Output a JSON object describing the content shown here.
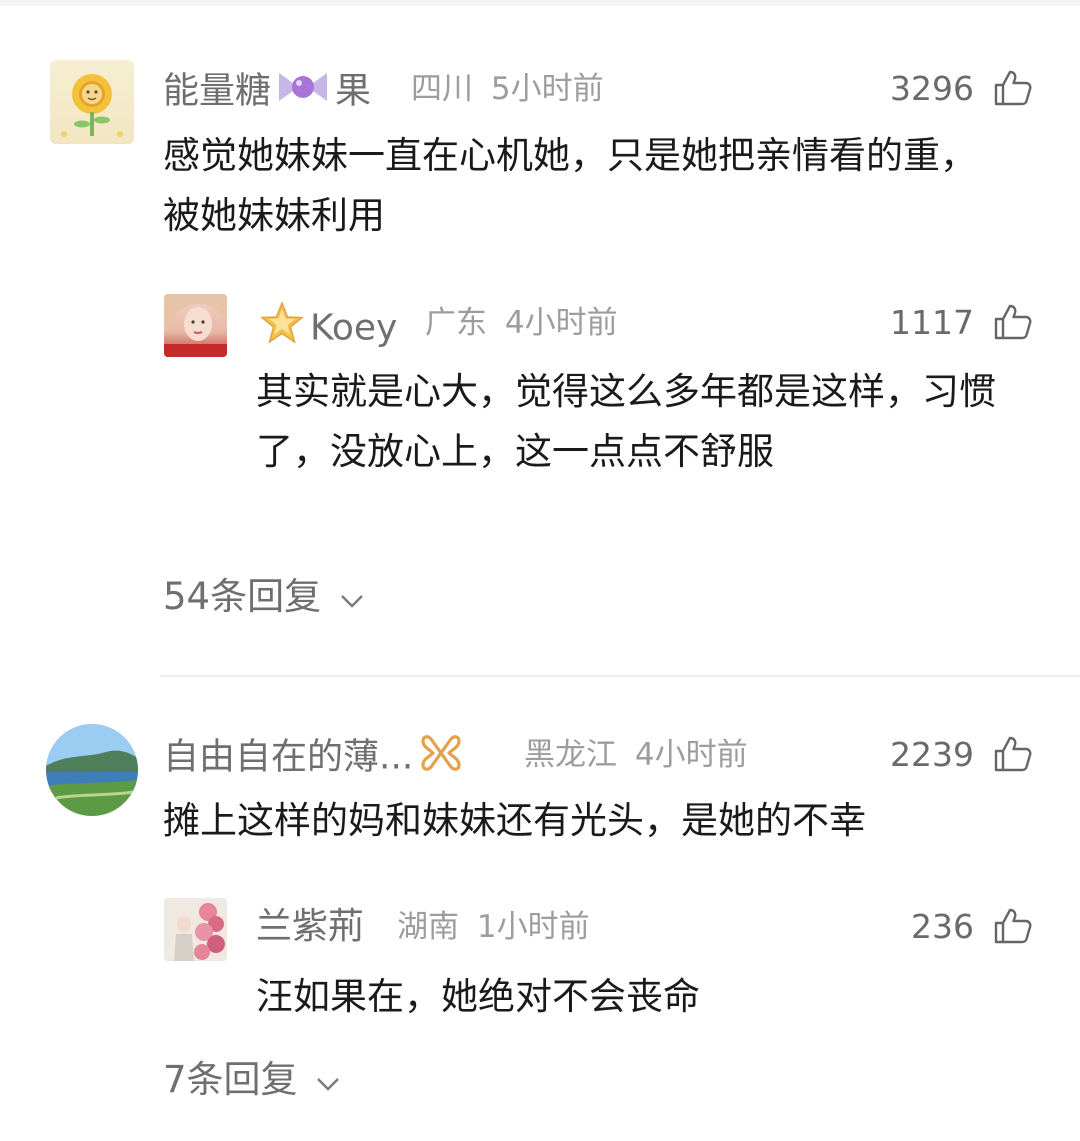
{
  "comments": [
    {
      "username": "能量糖",
      "username_suffix": "果",
      "name_emoji": "candy-emoji",
      "location": "四川",
      "time": "5小时前",
      "likes": "3296",
      "text": "感觉她妹妹一直在心机她，只是她把亲情看的重，被她妹妹利用",
      "avatar": "sunflower-avatar",
      "reply": {
        "username": "Koey",
        "name_emoji": "star-badge",
        "location": "广东",
        "time": "4小时前",
        "likes": "1117",
        "text": "其实就是心大，觉得这么多年都是这样，习惯了，没放心上，这一点点不舒服",
        "avatar": "girl-avatar"
      },
      "replies_label": "54条回复"
    },
    {
      "username": "自由自在的薄...",
      "name_emoji": "vip-ribbon-badge",
      "location": "黑龙江",
      "time": "4小时前",
      "likes": "2239",
      "text": "摊上这样的妈和妹妹还有光头，是她的不幸",
      "avatar": "landscape-avatar",
      "reply": {
        "username": "兰紫荊",
        "location": "湖南",
        "time": "1小时前",
        "likes": "236",
        "text": "汪如果在，她绝对不会丧命",
        "avatar": "flowers-avatar"
      },
      "replies_label": "7条回复"
    }
  ],
  "colors": {
    "name": "#6f6f6f",
    "meta": "#9d9d9d",
    "text": "#1a1a1a",
    "badge_gold": "#e3a24a"
  }
}
